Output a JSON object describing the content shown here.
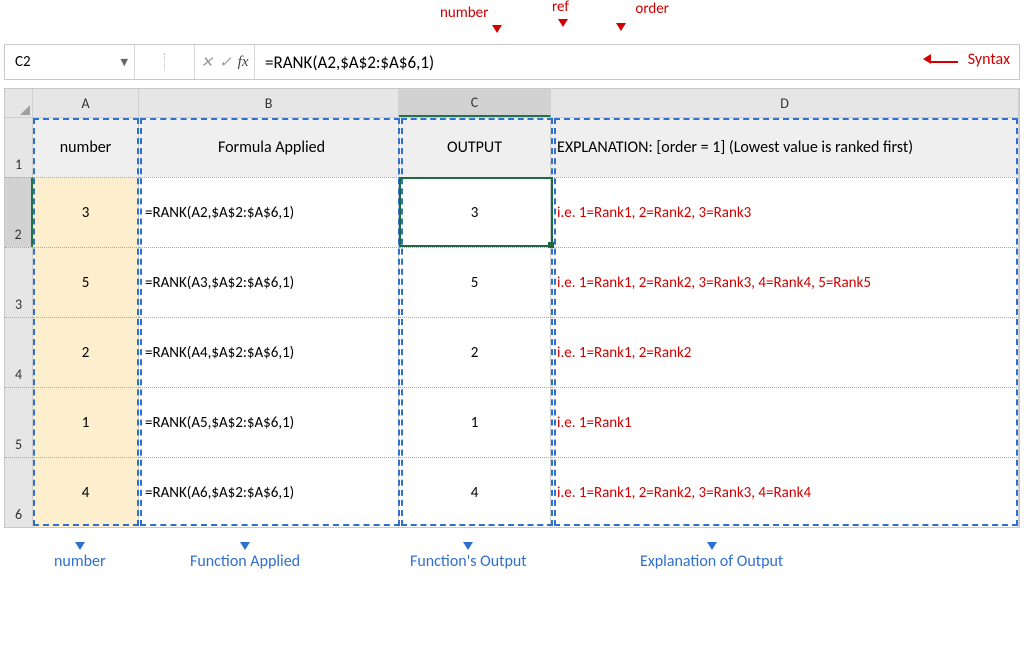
{
  "top_annotations": {
    "number": "number",
    "ref": "ref",
    "order": "order"
  },
  "formula_bar": {
    "name_box": "C2",
    "fx_label": "fx",
    "formula": "=RANK(A2,$A$2:$A$6,1)"
  },
  "syntax_label": "Syntax",
  "columns": {
    "a": "A",
    "b": "B",
    "c": "C",
    "d": "D"
  },
  "row_nums": [
    "1",
    "2",
    "3",
    "4",
    "5",
    "6"
  ],
  "headers": {
    "a": "number",
    "b": "Formula Applied",
    "c": "OUTPUT",
    "d": "EXPLANATION: [order = 1] (Lowest value is ranked first)"
  },
  "rows": [
    {
      "num": "3",
      "formula": "=RANK(A2,$A$2:$A$6,1)",
      "out": "3",
      "exp": "i.e. 1=Rank1, 2=Rank2, 3=Rank3"
    },
    {
      "num": "5",
      "formula": "=RANK(A3,$A$2:$A$6,1)",
      "out": "5",
      "exp": "i.e. 1=Rank1, 2=Rank2, 3=Rank3, 4=Rank4, 5=Rank5"
    },
    {
      "num": "2",
      "formula": "=RANK(A4,$A$2:$A$6,1)",
      "out": "2",
      "exp": "i.e. 1=Rank1, 2=Rank2"
    },
    {
      "num": "1",
      "formula": "=RANK(A5,$A$2:$A$6,1)",
      "out": "1",
      "exp": "i.e. 1=Rank1"
    },
    {
      "num": "4",
      "formula": "=RANK(A6,$A$2:$A$6,1)",
      "out": "4",
      "exp": "i.e. 1=Rank1, 2=Rank2, 3=Rank3, 4=Rank4"
    }
  ],
  "bottom_annotations": {
    "number": "number",
    "func": "Function Applied",
    "out": "Function's Output",
    "exp": "Explanation of Output"
  },
  "chart_data": {
    "type": "table",
    "title": "Excel RANK function with order=1 (ascending)",
    "columns": [
      "number",
      "Formula Applied",
      "OUTPUT",
      "EXPLANATION"
    ],
    "rows": [
      [
        3,
        "=RANK(A2,$A$2:$A$6,1)",
        3,
        "1=Rank1, 2=Rank2, 3=Rank3"
      ],
      [
        5,
        "=RANK(A3,$A$2:$A$6,1)",
        5,
        "1=Rank1, 2=Rank2, 3=Rank3, 4=Rank4, 5=Rank5"
      ],
      [
        2,
        "=RANK(A4,$A$2:$A$6,1)",
        2,
        "1=Rank1, 2=Rank2"
      ],
      [
        1,
        "=RANK(A5,$A$2:$A$6,1)",
        1,
        "1=Rank1"
      ],
      [
        4,
        "=RANK(A6,$A$2:$A$6,1)",
        4,
        "1=Rank1, 2=Rank2, 3=Rank3, 4=Rank4"
      ]
    ]
  }
}
